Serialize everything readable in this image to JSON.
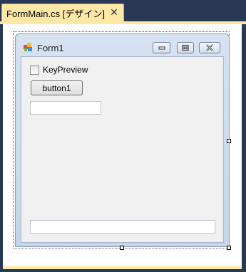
{
  "tab": {
    "title": "FormMain.cs [デザイン]",
    "close_glyph": "✕"
  },
  "form": {
    "title": "Form1",
    "icon": "form-app-icon",
    "controls": [
      "minimize",
      "maximize",
      "close"
    ]
  },
  "checkbox": {
    "label": "KeyPreview",
    "checked": false
  },
  "button": {
    "label": "button1"
  },
  "textbox_top": {
    "value": ""
  },
  "textbox_bottom": {
    "value": ""
  },
  "colors": {
    "frame": "#293955",
    "tab": "#ffe8a6",
    "form_client": "#f0f0f0",
    "titlebar": "#d6e2f2"
  }
}
